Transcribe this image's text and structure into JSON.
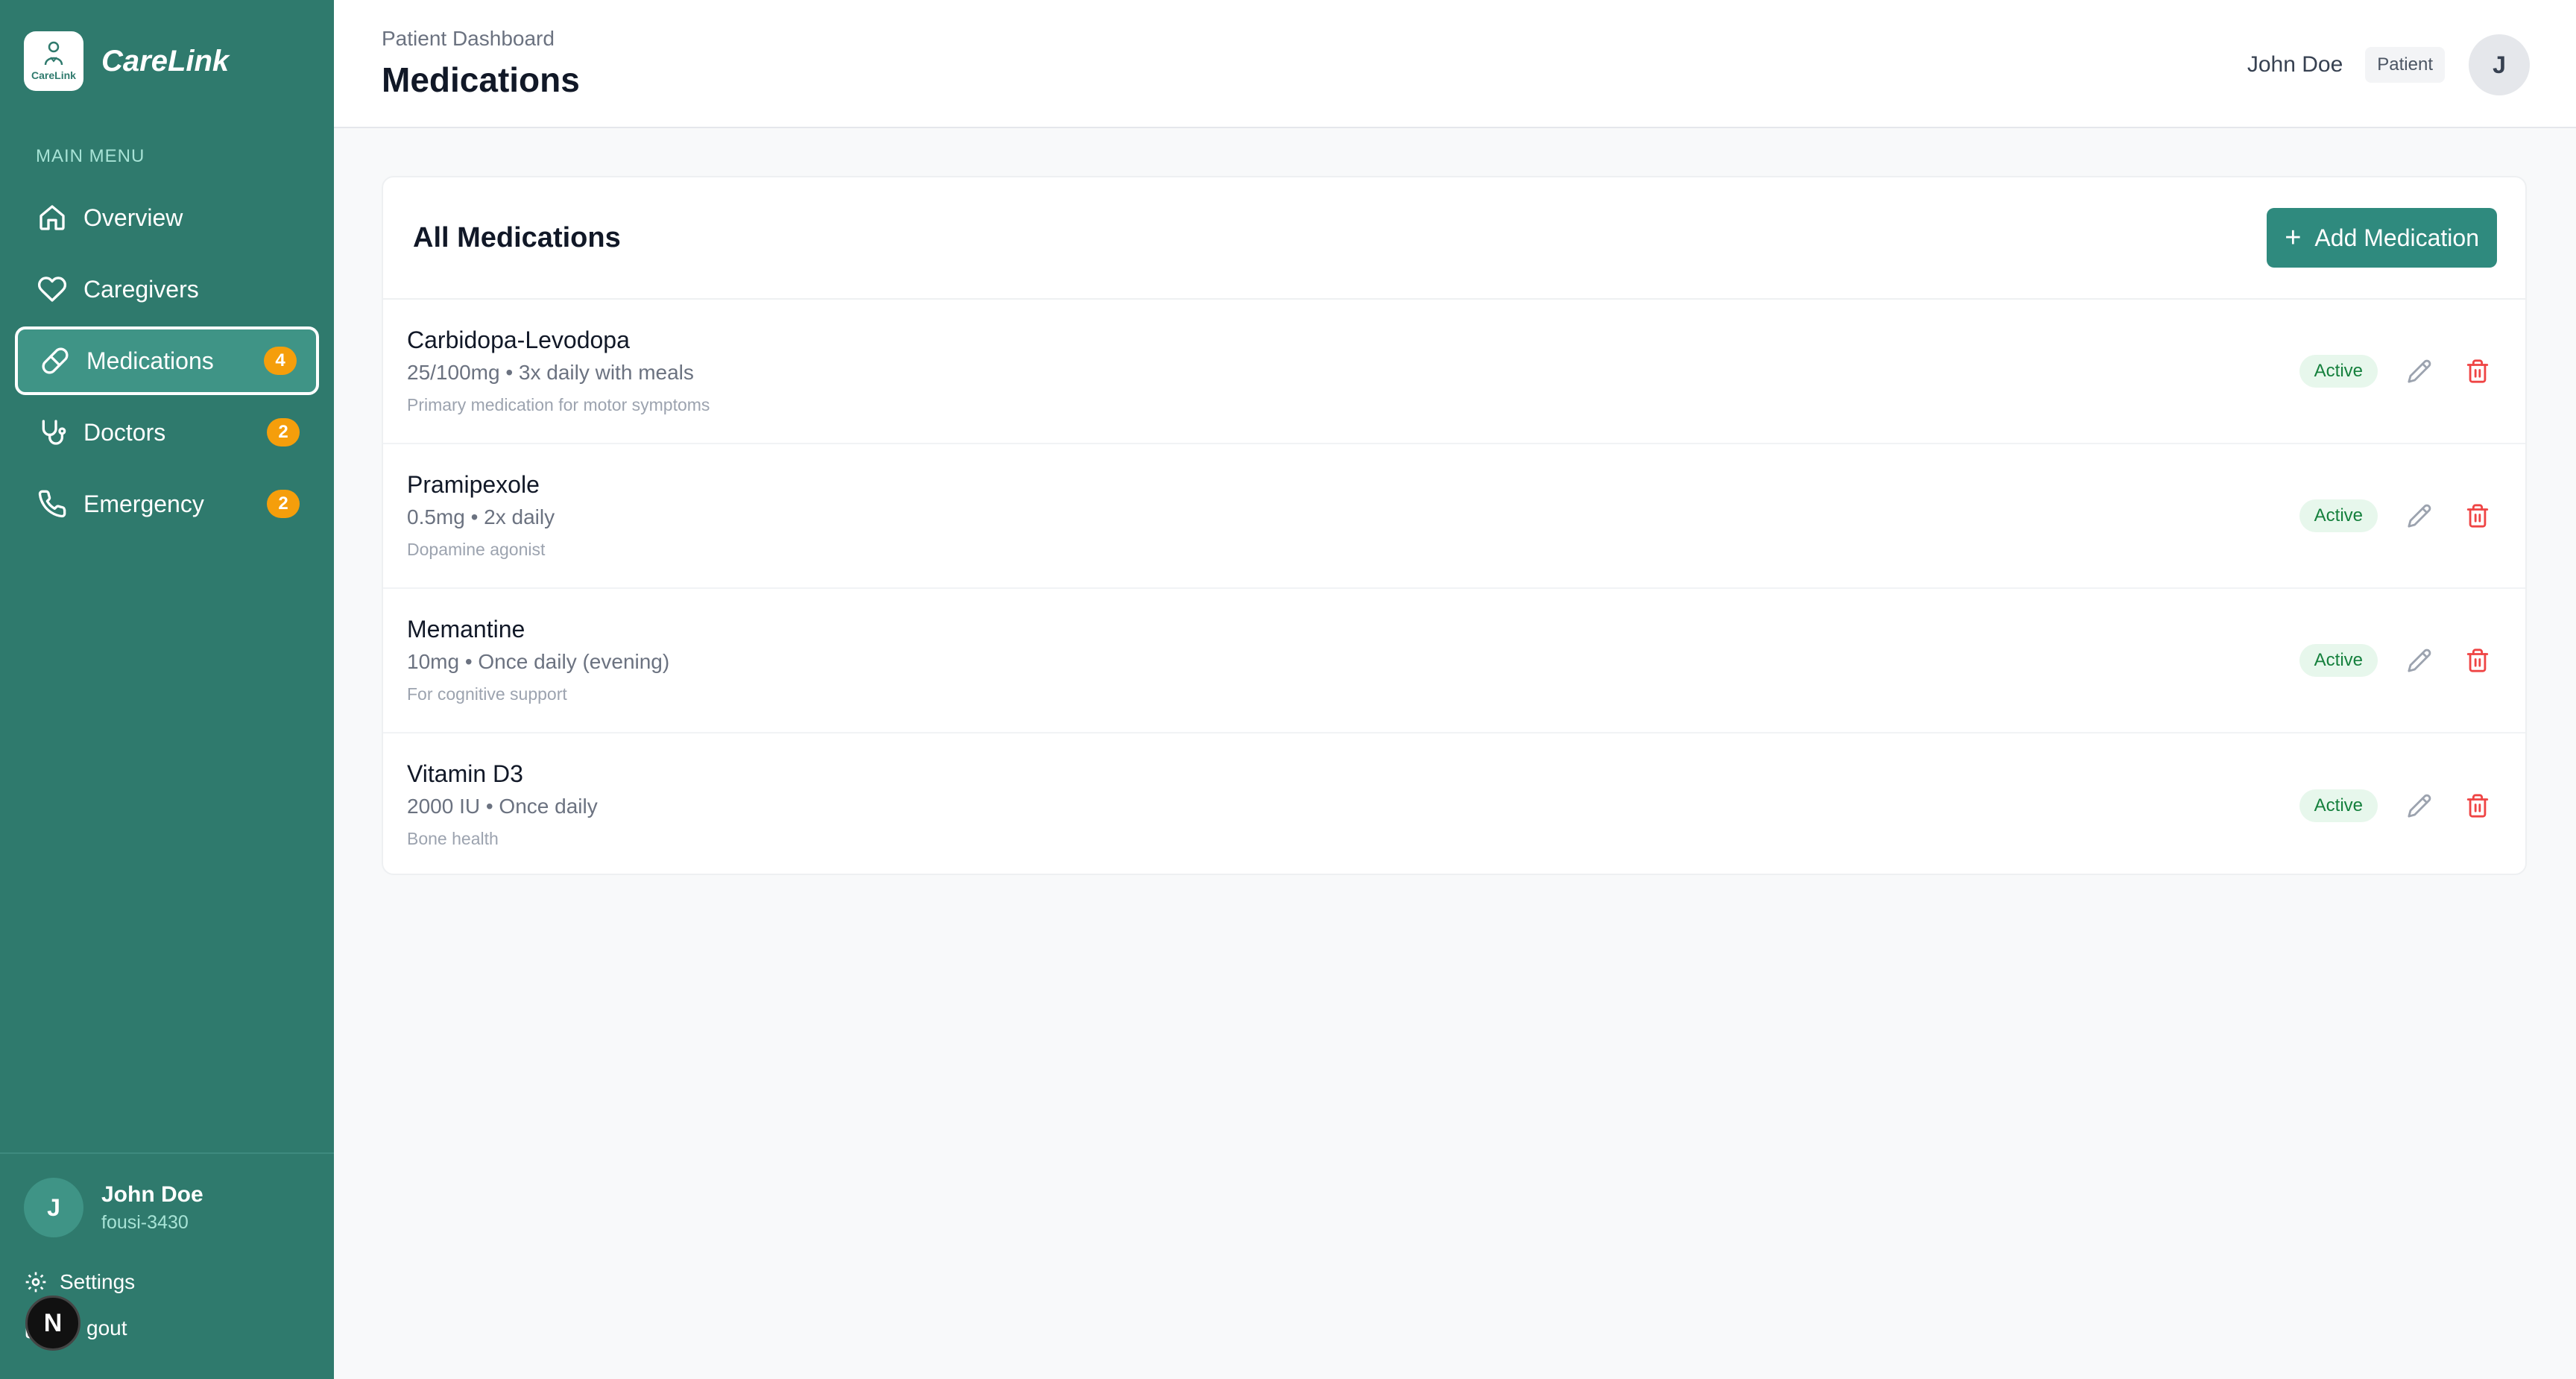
{
  "sidebar": {
    "brand_name": "CareLink",
    "logo_text": "CareLink",
    "menu_label": "MAIN MENU",
    "items": [
      {
        "label": "Overview",
        "icon": "home-icon"
      },
      {
        "label": "Caregivers",
        "icon": "heart-icon"
      },
      {
        "label": "Medications",
        "icon": "pill-icon",
        "badge": "4",
        "active": true
      },
      {
        "label": "Doctors",
        "icon": "stethoscope-icon",
        "badge": "2"
      },
      {
        "label": "Emergency",
        "icon": "phone-icon",
        "badge": "2"
      }
    ],
    "user": {
      "initial": "J",
      "name": "John Doe",
      "id": "fousi-3430"
    },
    "settings_label": "Settings",
    "logout_label": "gout",
    "n_badge": "N"
  },
  "header": {
    "breadcrumb": "Patient Dashboard",
    "title": "Medications",
    "user_name": "John Doe",
    "role": "Patient",
    "avatar_initial": "J"
  },
  "main": {
    "card_title": "All Medications",
    "add_button_label": "Add Medication",
    "medications": [
      {
        "name": "Carbidopa-Levodopa",
        "dose": "25/100mg • 3x daily with meals",
        "note": "Primary medication for motor symptoms",
        "status": "Active"
      },
      {
        "name": "Pramipexole",
        "dose": "0.5mg • 2x daily",
        "note": "Dopamine agonist",
        "status": "Active"
      },
      {
        "name": "Memantine",
        "dose": "10mg • Once daily (evening)",
        "note": "For cognitive support",
        "status": "Active"
      },
      {
        "name": "Vitamin D3",
        "dose": "2000 IU • Once daily",
        "note": "Bone health",
        "status": "Active"
      }
    ]
  },
  "colors": {
    "sidebar_bg": "#2f7a6d",
    "accent": "#2f8a7e",
    "badge": "#f59e0b",
    "active_status": "#15803d",
    "delete": "#ef4444"
  }
}
